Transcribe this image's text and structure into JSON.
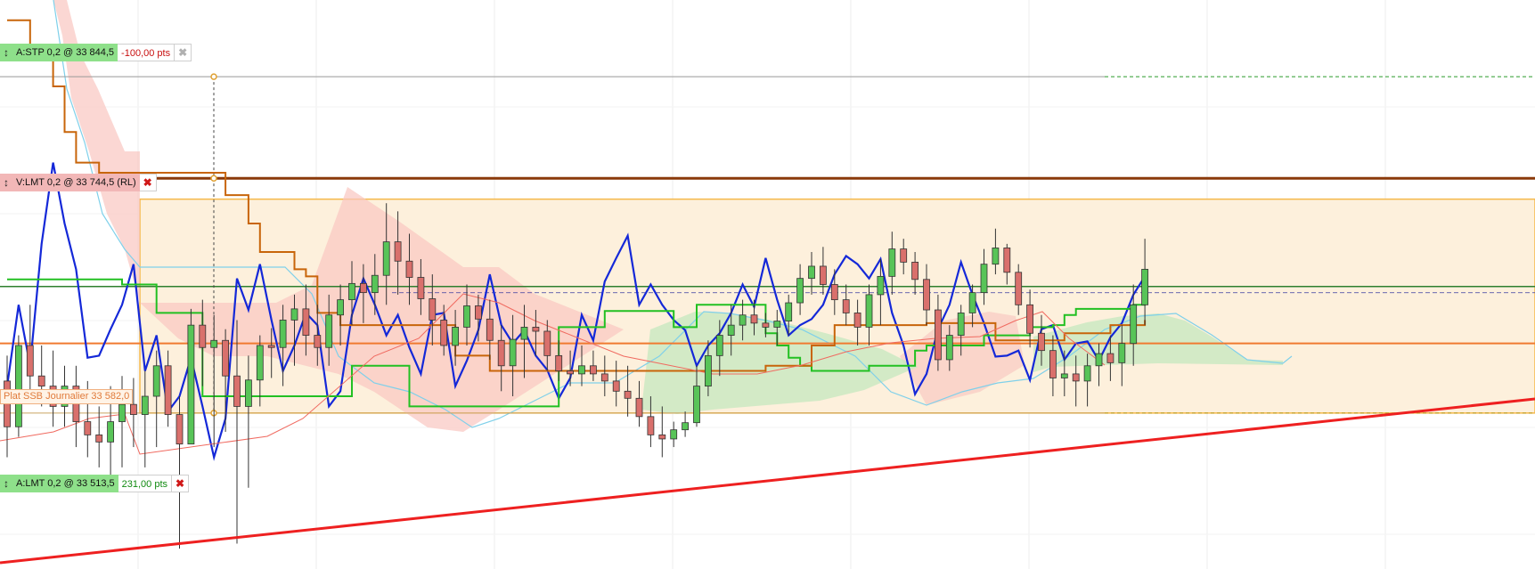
{
  "colors": {
    "bull_candle": "#58c458",
    "bear_candle": "#d9706c",
    "candle_wick": "#333333",
    "blue_line": "#1428d8",
    "green_line": "#22c022",
    "orange_line": "#c8650a",
    "thin_red_line": "#f06a60",
    "light_blue_line": "#7fd0ea",
    "trend_line": "#ee2020",
    "resistance_line": "#8a3a0a",
    "support_orange": "#f07a30",
    "dark_green_hline": "#2f7f2f",
    "range_fill": "#fdf0dc",
    "range_border": "#f5b84a",
    "cloud_bear_fill": "#f9c6c0",
    "cloud_bull_fill": "#c8e8c0"
  },
  "orders": {
    "stop": {
      "text": "A:STP  0,2 @ 33 844,5",
      "pts": "-100,00 pts",
      "pts_color": "#c81010",
      "close_color": "#b0b0b0",
      "grip_icon": "↕"
    },
    "sell": {
      "text": "V:LMT  0,2 @ 33 744,5 (RL)",
      "close_color": "#d01818",
      "grip_icon": "↕"
    },
    "buy": {
      "text": "A:LMT  0,2 @ 33 513,5",
      "pts": "231,00 pts",
      "pts_color": "#108a10",
      "close_color": "#d01818",
      "grip_icon": "↕"
    }
  },
  "levels": {
    "ssb_label": "Plat SSB Journalier 33 582,0"
  },
  "chart_data": {
    "type": "candlestick",
    "title": "",
    "price_range": [
      33360,
      33920
    ],
    "horizontal_levels": {
      "stop_order": 33844.5,
      "sell_limit": 33744.5,
      "range_top": 33724,
      "dark_green_line": 33638,
      "ssb_flat": 33582.0,
      "buy_limit": 33513.5
    },
    "candles_ohlc": [
      [
        33545,
        33570,
        33470,
        33500
      ],
      [
        33500,
        33590,
        33490,
        33580
      ],
      [
        33580,
        33620,
        33530,
        33550
      ],
      [
        33550,
        33580,
        33520,
        33540
      ],
      [
        33540,
        33575,
        33500,
        33520
      ],
      [
        33520,
        33560,
        33500,
        33540
      ],
      [
        33540,
        33560,
        33480,
        33505
      ],
      [
        33505,
        33545,
        33470,
        33492
      ],
      [
        33492,
        33520,
        33460,
        33485
      ],
      [
        33485,
        33540,
        33450,
        33505
      ],
      [
        33505,
        33550,
        33460,
        33522
      ],
      [
        33522,
        33548,
        33480,
        33512
      ],
      [
        33512,
        33555,
        33460,
        33530
      ],
      [
        33530,
        33575,
        33480,
        33560
      ],
      [
        33560,
        33575,
        33500,
        33512
      ],
      [
        33512,
        33530,
        33380,
        33483
      ],
      [
        33483,
        33616,
        33483,
        33600
      ],
      [
        33600,
        33625,
        33540,
        33578
      ],
      [
        33578,
        33610,
        33480,
        33585
      ],
      [
        33585,
        33596,
        33495,
        33550
      ],
      [
        33550,
        33605,
        33385,
        33520
      ],
      [
        33520,
        33570,
        33440,
        33546
      ],
      [
        33546,
        33590,
        33520,
        33580
      ],
      [
        33580,
        33597,
        33548,
        33578
      ],
      [
        33578,
        33620,
        33540,
        33605
      ],
      [
        33605,
        33630,
        33560,
        33616
      ],
      [
        33616,
        33640,
        33570,
        33590
      ],
      [
        33590,
        33620,
        33560,
        33578
      ],
      [
        33578,
        33630,
        33560,
        33610
      ],
      [
        33610,
        33640,
        33580,
        33625
      ],
      [
        33625,
        33663,
        33600,
        33641
      ],
      [
        33641,
        33660,
        33602,
        33632
      ],
      [
        33632,
        33670,
        33610,
        33649
      ],
      [
        33649,
        33720,
        33620,
        33682
      ],
      [
        33682,
        33712,
        33630,
        33663
      ],
      [
        33663,
        33690,
        33620,
        33647
      ],
      [
        33647,
        33665,
        33610,
        33626
      ],
      [
        33626,
        33650,
        33580,
        33605
      ],
      [
        33605,
        33620,
        33570,
        33580
      ],
      [
        33580,
        33615,
        33560,
        33598
      ],
      [
        33598,
        33640,
        33580,
        33619
      ],
      [
        33619,
        33630,
        33584,
        33606
      ],
      [
        33606,
        33625,
        33566,
        33585
      ],
      [
        33585,
        33600,
        33535,
        33560
      ],
      [
        33560,
        33610,
        33530,
        33586
      ],
      [
        33586,
        33620,
        33548,
        33598
      ],
      [
        33598,
        33615,
        33570,
        33594
      ],
      [
        33594,
        33605,
        33555,
        33570
      ],
      [
        33570,
        33585,
        33545,
        33555
      ],
      [
        33555,
        33575,
        33540,
        33552
      ],
      [
        33552,
        33580,
        33540,
        33560
      ],
      [
        33560,
        33575,
        33545,
        33552
      ],
      [
        33552,
        33570,
        33530,
        33545
      ],
      [
        33545,
        33565,
        33520,
        33535
      ],
      [
        33535,
        33560,
        33510,
        33528
      ],
      [
        33528,
        33545,
        33500,
        33510
      ],
      [
        33510,
        33530,
        33480,
        33492
      ],
      [
        33492,
        33520,
        33470,
        33488
      ],
      [
        33488,
        33505,
        33480,
        33497
      ],
      [
        33497,
        33515,
        33490,
        33504
      ],
      [
        33504,
        33560,
        33500,
        33540
      ],
      [
        33540,
        33585,
        33530,
        33570
      ],
      [
        33570,
        33605,
        33550,
        33590
      ],
      [
        33590,
        33620,
        33570,
        33600
      ],
      [
        33600,
        33625,
        33585,
        33610
      ],
      [
        33610,
        33625,
        33590,
        33602
      ],
      [
        33602,
        33612,
        33588,
        33598
      ],
      [
        33598,
        33615,
        33580,
        33604
      ],
      [
        33604,
        33630,
        33590,
        33622
      ],
      [
        33622,
        33660,
        33610,
        33646
      ],
      [
        33646,
        33672,
        33630,
        33658
      ],
      [
        33658,
        33677,
        33630,
        33640
      ],
      [
        33640,
        33655,
        33610,
        33625
      ],
      [
        33625,
        33640,
        33600,
        33612
      ],
      [
        33612,
        33625,
        33580,
        33598
      ],
      [
        33598,
        33640,
        33580,
        33630
      ],
      [
        33630,
        33665,
        33600,
        33648
      ],
      [
        33648,
        33692,
        33630,
        33675
      ],
      [
        33675,
        33685,
        33650,
        33662
      ],
      [
        33662,
        33672,
        33630,
        33645
      ],
      [
        33645,
        33660,
        33600,
        33615
      ],
      [
        33615,
        33630,
        33555,
        33566
      ],
      [
        33566,
        33600,
        33555,
        33590
      ],
      [
        33590,
        33620,
        33570,
        33612
      ],
      [
        33612,
        33640,
        33598,
        33632
      ],
      [
        33632,
        33675,
        33620,
        33660
      ],
      [
        33660,
        33695,
        33650,
        33676
      ],
      [
        33676,
        33680,
        33640,
        33652
      ],
      [
        33652,
        33660,
        33610,
        33620
      ],
      [
        33620,
        33635,
        33578,
        33592
      ],
      [
        33592,
        33610,
        33560,
        33575
      ],
      [
        33575,
        33590,
        33530,
        33548
      ],
      [
        33548,
        33575,
        33530,
        33552
      ],
      [
        33552,
        33570,
        33520,
        33545
      ],
      [
        33545,
        33572,
        33520,
        33560
      ],
      [
        33560,
        33582,
        33540,
        33572
      ],
      [
        33572,
        33590,
        33545,
        33563
      ],
      [
        33563,
        33600,
        33540,
        33582
      ],
      [
        33582,
        33640,
        33560,
        33620
      ],
      [
        33620,
        33685,
        33600,
        33655
      ]
    ],
    "series": [
      {
        "name": "",
        "color": "#1428d8",
        "values": [
          33540,
          33620,
          33560,
          33680,
          33760,
          33700,
          33655,
          33568,
          33570,
          33596,
          33620,
          33660,
          33555,
          33590,
          33515,
          33530,
          33568,
          33520,
          33470,
          33508,
          33646,
          33615,
          33660,
          33605,
          33555,
          33580,
          33612,
          33600,
          33520,
          33535,
          33610,
          33646,
          33620,
          33590,
          33610,
          33578,
          33552,
          33610,
          33612,
          33540,
          33565,
          33595,
          33650,
          33600,
          33582,
          33595,
          33570,
          33556,
          33528,
          33548,
          33610,
          33585,
          33643,
          33666,
          33688,
          33620,
          33640,
          33620,
          33605,
          33595,
          33560,
          33580,
          33592,
          33612,
          33640,
          33618,
          33666,
          33625,
          33590,
          33600,
          33606,
          33620,
          33650,
          33668,
          33660,
          33646,
          33665,
          33612,
          33580,
          33532,
          33552,
          33596,
          33620,
          33662,
          33630,
          33602,
          33569,
          33570,
          33575,
          33546,
          33596,
          33600,
          33566,
          33582,
          33584,
          33565,
          33588,
          33602,
          33630,
          33648
        ]
      },
      {
        "name": "",
        "color": "#22c022",
        "values": [
          33645,
          33645,
          33645,
          33645,
          33645,
          33645,
          33645,
          33645,
          33645,
          33645,
          33640,
          33640,
          33640,
          33612,
          33612,
          33612,
          33612,
          33530,
          33530,
          33530,
          33530,
          33530,
          33530,
          33530,
          33530,
          33530,
          33530,
          33530,
          33530,
          33530,
          33560,
          33560,
          33560,
          33560,
          33560,
          33520,
          33520,
          33520,
          33520,
          33520,
          33520,
          33520,
          33520,
          33520,
          33520,
          33520,
          33520,
          33520,
          33598,
          33598,
          33598,
          33598,
          33614,
          33614,
          33614,
          33614,
          33614,
          33614,
          33598,
          33598,
          33620,
          33620,
          33620,
          33620,
          33620,
          33620,
          33592,
          33580,
          33568,
          33560,
          33555,
          33555,
          33555,
          33555,
          33555,
          33560,
          33560,
          33560,
          33560,
          33575,
          33580,
          33580,
          33580,
          33580,
          33580,
          33590,
          33590,
          33590,
          33590,
          33598,
          33598,
          33600,
          33610,
          33616,
          33616,
          33616,
          33616,
          33616,
          33620,
          33624
        ]
      },
      {
        "name": "",
        "color": "#c8650a",
        "values": [
          33900,
          33900,
          33870,
          33870,
          33835,
          33790,
          33760,
          33760,
          33750,
          33750,
          33750,
          33750,
          33750,
          33750,
          33750,
          33750,
          33750,
          33750,
          33750,
          33728,
          33728,
          33700,
          33672,
          33672,
          33672,
          33655,
          33648,
          33612,
          33612,
          33600,
          33600,
          33600,
          33600,
          33600,
          33600,
          33600,
          33600,
          33600,
          33600,
          33570,
          33570,
          33570,
          33555,
          33555,
          33555,
          33555,
          33555,
          33555,
          33555,
          33555,
          33555,
          33555,
          33555,
          33555,
          33555,
          33555,
          33555,
          33555,
          33555,
          33555,
          33555,
          33555,
          33555,
          33555,
          33555,
          33555,
          33560,
          33560,
          33560,
          33560,
          33580,
          33580,
          33600,
          33600,
          33600,
          33600,
          33600,
          33600,
          33600,
          33600,
          33602,
          33602,
          33602,
          33602,
          33602,
          33602,
          33585,
          33585,
          33585,
          33585,
          33585,
          33585,
          33592,
          33592,
          33592,
          33592,
          33600,
          33600,
          33600,
          33605
        ]
      }
    ]
  }
}
